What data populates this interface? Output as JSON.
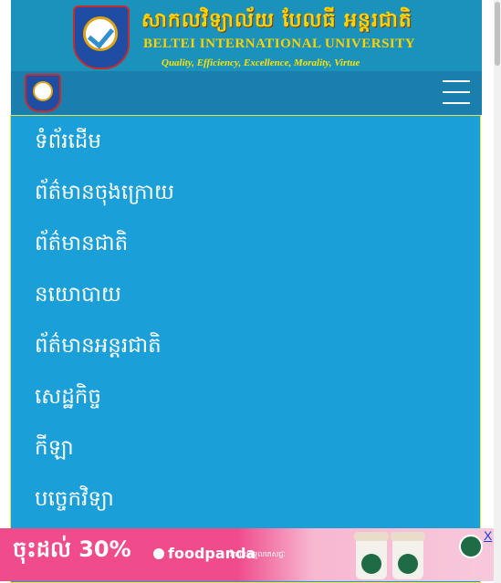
{
  "header": {
    "title_khmer": "សាកលវិទ្យាល័យ បែលធី អន្តរជាតិ",
    "title_english": "BELTEI INTERNATIONAL UNIVERSITY",
    "tagline": "Quality, Efficiency, Excellence, Morality, Virtue"
  },
  "menu": {
    "items": [
      {
        "label": "ទំព័រដើម"
      },
      {
        "label": "ព័ត៌មានចុងក្រោយ"
      },
      {
        "label": "ព័ត៌មានជាតិ"
      },
      {
        "label": "នយោបាយ"
      },
      {
        "label": "ព័ត៌មានអន្តរជាតិ"
      },
      {
        "label": "សេដ្ឋកិច្ច"
      },
      {
        "label": "កីឡា"
      },
      {
        "label": "បច្ចេកវិទ្យា"
      }
    ]
  },
  "ad": {
    "headline": "ចុះដល់ 30%",
    "brand": "foodpanda",
    "subtext": "រីករាយទទួលភេសជ្ជៈ",
    "close_label": "X"
  },
  "colors": {
    "banner": "#1a92bc",
    "navbar": "#1a7fad",
    "menu": "#1a9fd9",
    "ad": "#f04c8c"
  }
}
